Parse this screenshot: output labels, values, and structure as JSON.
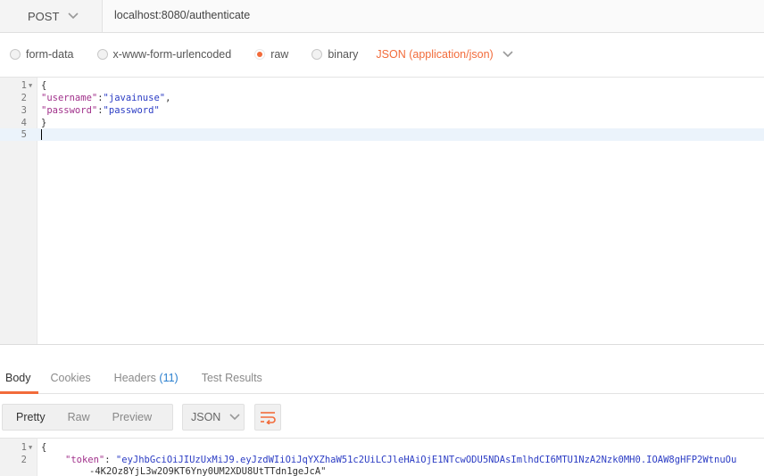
{
  "request": {
    "method": "POST",
    "url": "localhost:8080/authenticate"
  },
  "body_types": [
    {
      "label": "form-data",
      "selected": false
    },
    {
      "label": "x-www-form-urlencoded",
      "selected": false
    },
    {
      "label": "raw",
      "selected": true
    },
    {
      "label": "binary",
      "selected": false
    }
  ],
  "content_type": "JSON (application/json)",
  "editor": {
    "line_numbers": [
      "1",
      "2",
      "3",
      "4",
      "5"
    ],
    "open_brace": "{",
    "username_key": "\"username\"",
    "username_value": "\"javainuse\"",
    "password_key": "\"password\"",
    "password_value": "\"password\"",
    "close_brace": "}"
  },
  "response_tabs": {
    "body": "Body",
    "cookies": "Cookies",
    "headers": "Headers",
    "headers_count": "(11)",
    "test_results": "Test Results"
  },
  "response_toolbar": {
    "pretty": "Pretty",
    "raw": "Raw",
    "preview": "Preview",
    "format": "JSON",
    "wrap_icon": "wrap-lines-icon"
  },
  "response": {
    "line_numbers": [
      "1",
      "2"
    ],
    "open_brace": "{",
    "token_key": "\"token\"",
    "token_value_line1": "\"eyJhbGciOiJIUzUxMiJ9.eyJzdWIiOiJqYXZhaW51c2UiLCJleHAiOjE1NTcwODU5NDAsImlhdCI6MTU1NzA2Nzk0MH0.IOAW8gHFP2WtnuOu",
    "token_value_line2": "-4K2Oz8YjL3w2O9KT6Yny0UM2XDU8UtTTdn1geJcA\""
  },
  "colors": {
    "accent": "#f26b3a",
    "json_key": "#a1318b",
    "json_string": "#2b3cc4",
    "count": "#2a7fcf"
  }
}
